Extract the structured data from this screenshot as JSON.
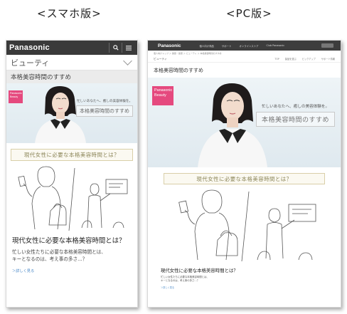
{
  "captions": {
    "sp": "<スマホ版>",
    "pc": "<PC版>"
  },
  "sp": {
    "logo": "Panasonic",
    "menu_label": "ビューティ",
    "page_title": "本格美容時間のすすめ",
    "hero": {
      "badge": "Panasonic Beauty",
      "copy_line": "忙しいあなたへ、癒しの美容体験を。",
      "copy_main": "本格美容時間のすすめ"
    },
    "banner": "現代女性に必要な本格美容時間とは？",
    "article": {
      "title": "現代女性に必要な本格美容時間とは？",
      "body_line1": "忙しい女性たちに必要な本格美容時間とは、",
      "body_line2": "キーとなるのは、考え事の多さ…？",
      "more": "＞詳しく見る"
    }
  },
  "pc": {
    "logo": "Panasonic",
    "nav": [
      "個人向け商品",
      "サポート",
      "オンラインストア",
      "Club Panasonic"
    ],
    "breadcrumb": "個人向けトップ ＞ 美容・健康 ＞ ビューティ ＞ 本格美容時間のすすめ",
    "category": "ビューティ",
    "subnav": [
      "TOP",
      "製品を選ぶ",
      "ビックアップ",
      "サポート情報"
    ],
    "page_title": "本格美容時間のすすめ",
    "hero": {
      "badge": "Panasonic Beauty",
      "copy_line": "忙しいあなたへ、癒しの美容体験を。",
      "copy_main": "本格美容時間のすすめ"
    },
    "banner": "現代女性に必要な本格美容時間とは？",
    "article": {
      "title": "現代女性に必要な本格美容時間とは？",
      "body_line1": "忙しい女性たちに必要な本格美容時間とは、",
      "body_line2": "キーとなるのは、考え事の多さ…？",
      "more": "＞詳しく見る"
    }
  },
  "colors": {
    "header": "#3a3a3a",
    "badge": "#e5497e",
    "banner_border": "#d9cfa8",
    "link": "#4a89c8"
  },
  "icons": {
    "search": "search-icon",
    "menu": "hamburger-icon"
  }
}
